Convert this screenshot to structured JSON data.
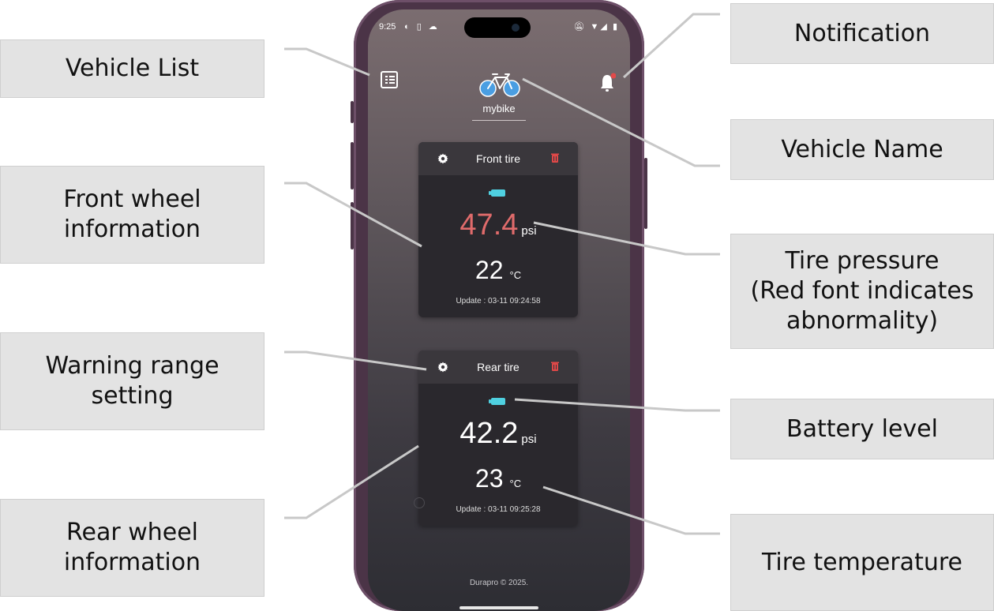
{
  "callouts": {
    "vehicle_list": "Vehicle List",
    "front_wheel_info": "Front wheel\ninformation",
    "warning_range": "Warning range\nsetting",
    "rear_wheel_info": "Rear wheel\ninformation",
    "notification": "Notification",
    "vehicle_name": "Vehicle Name",
    "tire_pressure": "Tire pressure\n(Red font indicates\nabnormality)",
    "battery_level": "Battery level",
    "tire_temperature": "Tire temperature"
  },
  "status_bar": {
    "time": "9:25"
  },
  "app": {
    "vehicle_name": "mybike",
    "footer": "Durapro © 2025."
  },
  "tires": {
    "front": {
      "title": "Front tire",
      "pressure": "47.4",
      "pressure_unit": "psi",
      "pressure_color": "#e06b6b",
      "temperature": "22",
      "temperature_unit": "°C",
      "update": "Update : 03-11 09:24:58"
    },
    "rear": {
      "title": "Rear tire",
      "pressure": "42.2",
      "pressure_unit": "psi",
      "pressure_color": "#ffffff",
      "temperature": "23",
      "temperature_unit": "°C",
      "update": "Update : 03-11 09:25:28"
    }
  },
  "colors": {
    "battery": "#4fd0e0",
    "wheel": "#4a9ee2",
    "alert_red": "#e06b6b",
    "trash": "#e04848"
  }
}
